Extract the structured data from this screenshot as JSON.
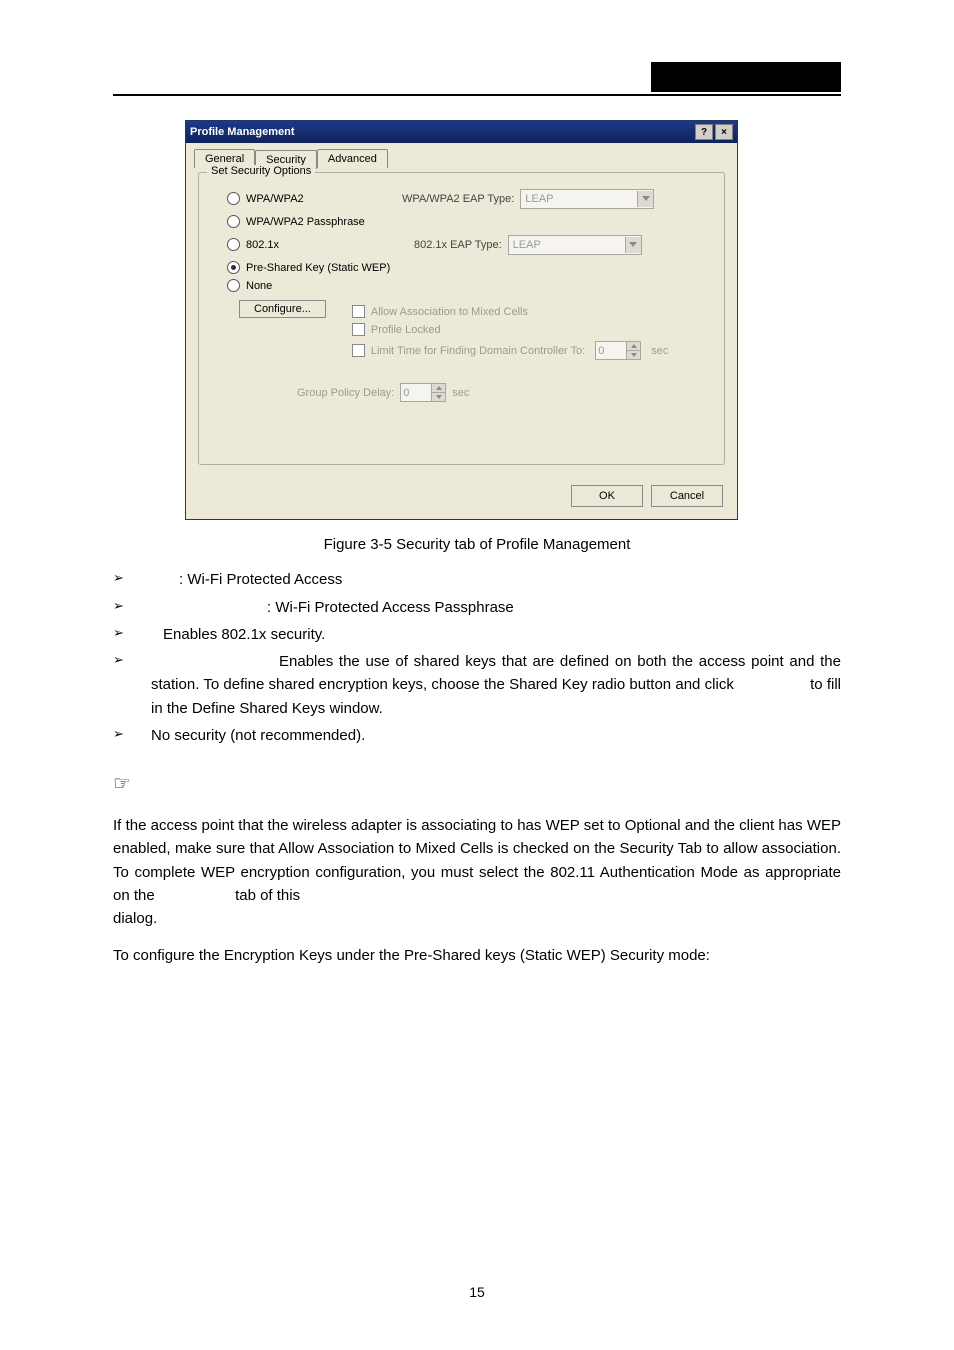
{
  "dialog": {
    "title": "Profile Management",
    "help_btn": "?",
    "close_btn": "×",
    "tabs": {
      "general": "General",
      "security": "Security",
      "advanced": "Advanced"
    },
    "group_title": "Set Security Options",
    "radios": {
      "wpa": "WPA/WPA2",
      "wpapass": "WPA/WPA2 Passphrase",
      "dot1x": "802.1x",
      "psk": "Pre-Shared Key (Static WEP)",
      "none": "None"
    },
    "eap": {
      "wpa_label": "WPA/WPA2 EAP Type:",
      "wpa_value": "LEAP",
      "dot1x_label": "802.1x EAP Type:",
      "dot1x_value": "LEAP"
    },
    "configure_btn": "Configure...",
    "checks": {
      "mixed": "Allow Association to Mixed Cells",
      "locked": "Profile Locked",
      "limit": "Limit Time for Finding Domain Controller To:"
    },
    "limit_value": "0",
    "limit_unit": "sec",
    "gpd_label": "Group Policy Delay:",
    "gpd_value": "0",
    "gpd_unit": "sec",
    "ok": "OK",
    "cancel": "Cancel"
  },
  "text": {
    "caption": "Figure 3-5 Security tab of Profile Management",
    "b1": ": Wi-Fi Protected Access",
    "b2": ": Wi-Fi Protected Access Passphrase",
    "b3": "Enables 802.1x security.",
    "b4_a": "Enables the use of shared keys that are defined on both the access point and the station. To define shared encryption keys, choose the Shared Key radio button and click",
    "b4_b": "to fill in the Define Shared Keys window.",
    "b5": "No security (not recommended).",
    "note1": "If the access point that the wireless adapter is associating to has WEP set to Optional and the client has WEP enabled, make sure that Allow Association to Mixed Cells is checked on the Security Tab to allow association. To complete WEP encryption configuration, you must select the 802.11 Authentication Mode as appropriate on the",
    "note1b": "tab of this",
    "note1c": "dialog.",
    "final": "To configure the Encryption Keys under the Pre-Shared keys (Static WEP) Security mode:"
  },
  "page_number": "15"
}
